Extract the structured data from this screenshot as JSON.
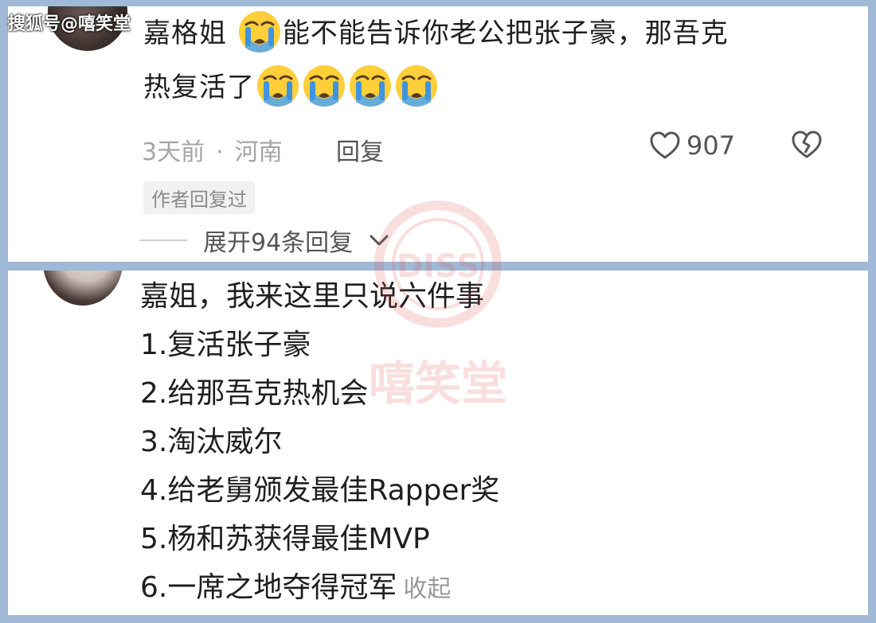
{
  "watermark": {
    "source": "搜狐号@嘻笑堂",
    "logo_circle_text": "DISS",
    "logo_text": "嘻笑堂"
  },
  "comment1": {
    "text_part1": "嘉格姐 ",
    "text_part2": "能不能告诉你老公把张子豪，那吾克",
    "text_part3": "热复活了",
    "emoji_name": "crying-face",
    "time": "3天前",
    "separator": "·",
    "location": "河南",
    "reply_label": "回复",
    "likes": "907",
    "badge": "作者回复过",
    "expand_label": "展开94条回复"
  },
  "comment2": {
    "lines": [
      "嘉姐，我来这里只说六件事",
      "1.复活张子豪",
      "2.给那吾克热机会",
      "3.淘汰威尔",
      "4.给老舅颁发最佳Rapper奖",
      "5.杨和苏获得最佳MVP",
      "6.一席之地夺得冠军"
    ],
    "collapse_label": "收起"
  },
  "colors": {
    "background": "#9fb9d6",
    "card": "#ffffff",
    "text": "#1f1f1f",
    "muted": "#a5a5a5",
    "watermark": "#e05050"
  }
}
